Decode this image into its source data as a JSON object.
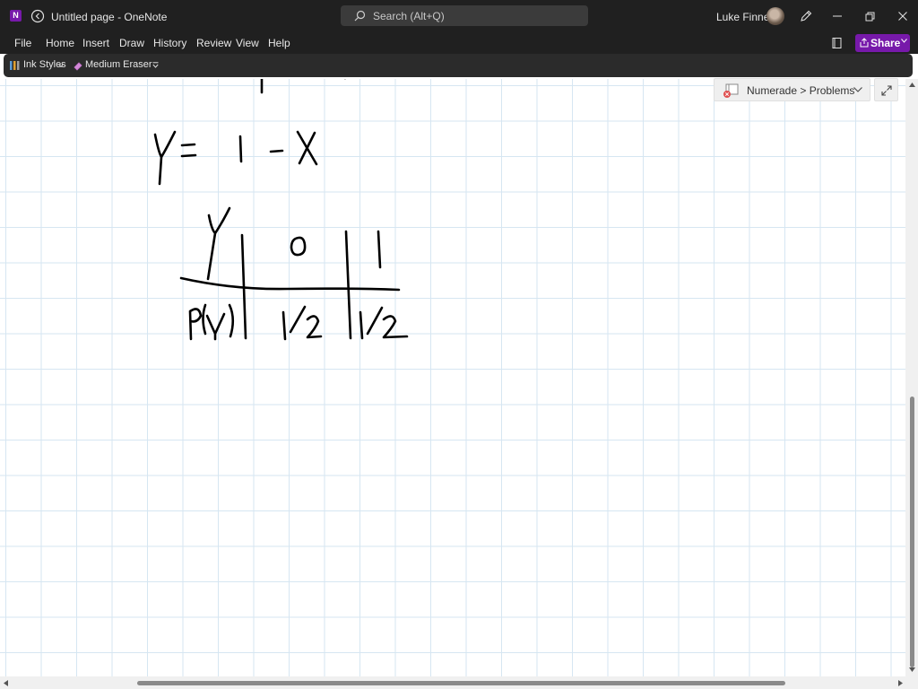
{
  "window": {
    "title": "Untitled page",
    "app_name": "OneNote",
    "separator": "-",
    "search_placeholder": "Search (Alt+Q)",
    "user_name": "Luke Finney"
  },
  "menu": {
    "items": [
      "File",
      "Home",
      "Insert",
      "Draw",
      "History",
      "Review",
      "View",
      "Help"
    ],
    "share_label": "Share"
  },
  "toolbar": {
    "ink_styles_label": "Ink Styles",
    "eraser_label": "Medium Eraser"
  },
  "navigation": {
    "breadcrumb": "Numerade > Problems"
  },
  "ink": {
    "equation": "Y = 1 - X",
    "table_row_header_1": "Y",
    "table_row_header_2": "P(Y)",
    "values": [
      "0",
      "1"
    ],
    "probabilities": [
      "1/2",
      "1/2"
    ]
  },
  "colors": {
    "accent": "#7719aa",
    "titlebar": "#202020",
    "toolbar": "#2b2b2b",
    "grid": "#d6e6f2"
  }
}
